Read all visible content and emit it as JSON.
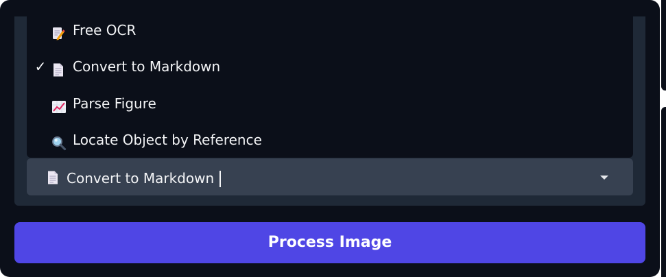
{
  "dropdown": {
    "options": [
      {
        "label": "Free OCR",
        "icon": "memo-pencil-icon",
        "selected": false
      },
      {
        "label": "Convert to Markdown",
        "icon": "page-document-icon",
        "selected": true
      },
      {
        "label": "Parse Figure",
        "icon": "chart-increasing-icon",
        "selected": false
      },
      {
        "label": "Locate Object by Reference",
        "icon": "magnifier-icon",
        "selected": false
      }
    ],
    "check_mark": "✓",
    "selected_value": "Convert to Markdown",
    "selected_icon": "page-document-icon"
  },
  "button": {
    "label": "Process Image"
  },
  "colors": {
    "background": "#0b0f19",
    "panel": "#1f2937",
    "select": "#374151",
    "accent": "#4f46e5",
    "text": "#f3f4f6"
  }
}
